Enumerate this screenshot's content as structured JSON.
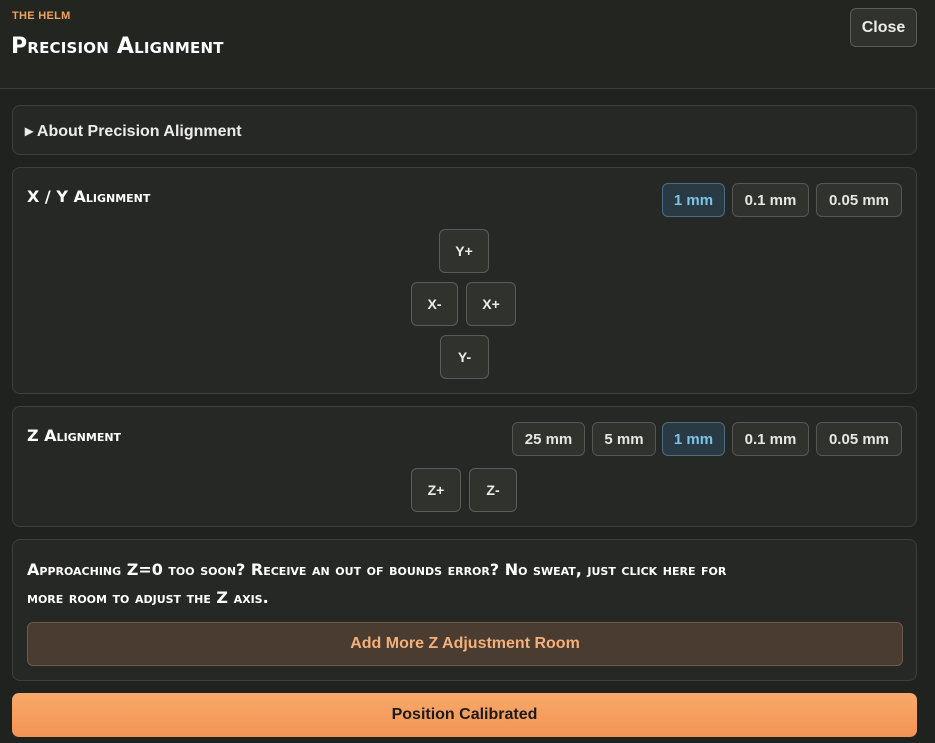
{
  "header": {
    "eyebrow": "THE HELM",
    "title": "Precision Alignment",
    "close_label": "Close"
  },
  "about": {
    "label": "▸ About Precision Alignment"
  },
  "xy": {
    "title": "X / Y Alignment",
    "steps": [
      "1 mm",
      "0.1 mm",
      "0.05 mm"
    ],
    "selected_step": "1 mm",
    "jog": {
      "y_plus": "Y+",
      "x_minus": "X-",
      "x_plus": "X+",
      "y_minus": "Y-"
    }
  },
  "z": {
    "title": "Z Alignment",
    "steps": [
      "25 mm",
      "5 mm",
      "1 mm",
      "0.1 mm",
      "0.05 mm"
    ],
    "selected_step": "1 mm",
    "jog": {
      "z_plus": "Z+",
      "z_minus": "Z-"
    }
  },
  "info": {
    "text_line1": "Approaching Z=0 too soon? Receive an out of bounds error? No sweat, just click here for",
    "text_line2": "more room to adjust the Z axis.",
    "button_label": "Add More Z Adjustment Room"
  },
  "footer": {
    "calibrated_label": "Position Calibrated"
  },
  "colors": {
    "accent": "#f29454",
    "selected_step": "#7cc4e6",
    "background": "#20221f"
  }
}
